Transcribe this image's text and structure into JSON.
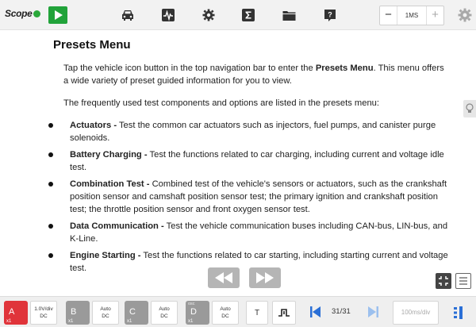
{
  "app": {
    "brand": "Scope",
    "colors": {
      "accent_green": "#21a33a",
      "channel_a": "#e0343a",
      "channel_other": "#9a9a9a",
      "nav_blue": "#2a6fd6"
    }
  },
  "topbar": {
    "icons": [
      "play-icon",
      "car-icon",
      "waveform-icon",
      "gear-icon",
      "sigma-icon",
      "folder-icon",
      "help-icon",
      "settings-icon"
    ],
    "zoom": {
      "minus": "−",
      "value": "1MS",
      "plus": "+"
    }
  },
  "content": {
    "title": "Presets Menu",
    "intro_before": "Tap the vehicle icon button in the top navigation bar to enter the ",
    "intro_bold": "Presets Menu",
    "intro_after": ". This menu offers a wide variety of preset guided information for you to view.",
    "list_intro": "The frequently used test components and options are listed in the presets menu:",
    "items": [
      {
        "name": "Actuators -",
        "text": " Test the common car actuators such as injectors, fuel pumps, and canister purge solenoids."
      },
      {
        "name": "Battery Charging -",
        "text": " Test the functions related to car charging, including current and voltage idle test."
      },
      {
        "name": "Combination Test -",
        "text": " Combined test of the vehicle's sensors or actuators, such as the crankshaft position sensor and camshaft position sensor test; the primary ignition and crankshaft position test; the throttle position sensor and front oxygen sensor test."
      },
      {
        "name": "Data Communication -",
        "text": " Test the vehicle communication buses including CAN-bus, LIN-bus, and K-Line."
      },
      {
        "name": "Engine Starting -",
        "text": " Test the functions related to car starting, including starting current and voltage test."
      }
    ]
  },
  "bottombar": {
    "channels": [
      {
        "letter": "A",
        "sub": "x1",
        "sup": "",
        "info_line1": "1.0V/div",
        "info_line2": "DC",
        "active": true
      },
      {
        "letter": "B",
        "sub": "x1",
        "sup": "",
        "info_line1": "Auto",
        "info_line2": "DC",
        "active": false
      },
      {
        "letter": "C",
        "sub": "x1",
        "sup": "",
        "info_line1": "Auto",
        "info_line2": "DC",
        "active": false
      },
      {
        "letter": "D",
        "sub": "x1",
        "sup": "osc",
        "info_line1": "Auto",
        "info_line2": "DC",
        "active": false
      }
    ],
    "trigger_label": "T",
    "page_count": "31/31",
    "timebase": "100ms/div"
  }
}
